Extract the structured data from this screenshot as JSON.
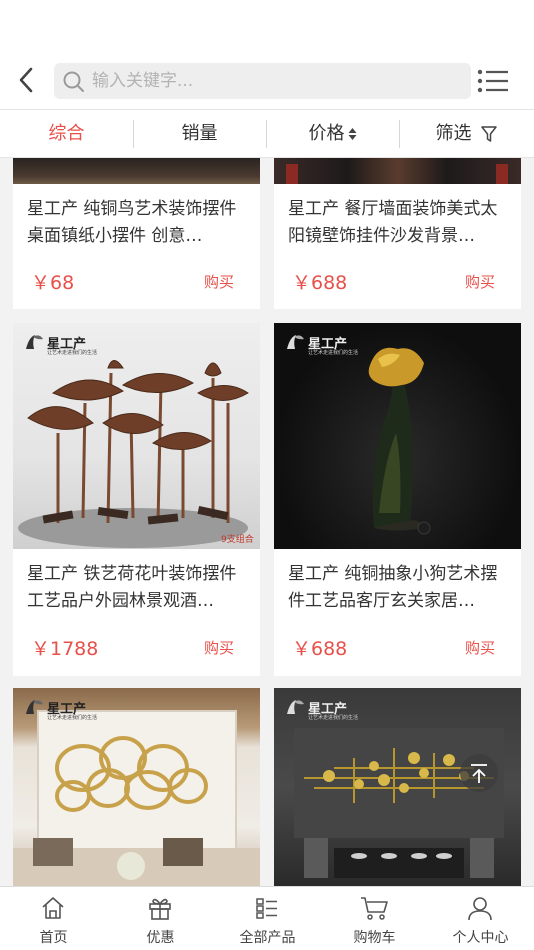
{
  "search": {
    "placeholder": "输入关键字..."
  },
  "filters": [
    {
      "label": "综合",
      "active": true
    },
    {
      "label": "销量",
      "active": false
    },
    {
      "label": "价格",
      "active": false
    },
    {
      "label": "筛选",
      "active": false
    }
  ],
  "brand": {
    "name": "星工产",
    "slogan": "让艺术走进我们的生活"
  },
  "products": [
    {
      "title": "星工产 纯铜鸟艺术装饰摆件桌面镇纸小摆件 创意…",
      "price": "￥68",
      "buy": "购买"
    },
    {
      "title": "星工产 餐厅墙面装饰美式太阳镜壁饰挂件沙发背景…",
      "price": "￥688",
      "buy": "购买"
    },
    {
      "title": "星工产 铁艺荷花叶装饰摆件工艺品户外园林景观酒…",
      "price": "￥1788",
      "buy": "购买",
      "image_tag": "9支组合"
    },
    {
      "title": "星工产 纯铜抽象小狗艺术摆件工艺品客厅玄关家居…",
      "price": "￥688",
      "buy": "购买"
    }
  ],
  "tabbar": [
    {
      "label": "首页",
      "icon": "home-icon"
    },
    {
      "label": "优惠",
      "icon": "gift-icon"
    },
    {
      "label": "全部产品",
      "icon": "list-icon"
    },
    {
      "label": "购物车",
      "icon": "cart-icon"
    },
    {
      "label": "个人中心",
      "icon": "user-icon"
    }
  ],
  "colors": {
    "accent": "#e8504a",
    "background": "#f2f2f2"
  }
}
